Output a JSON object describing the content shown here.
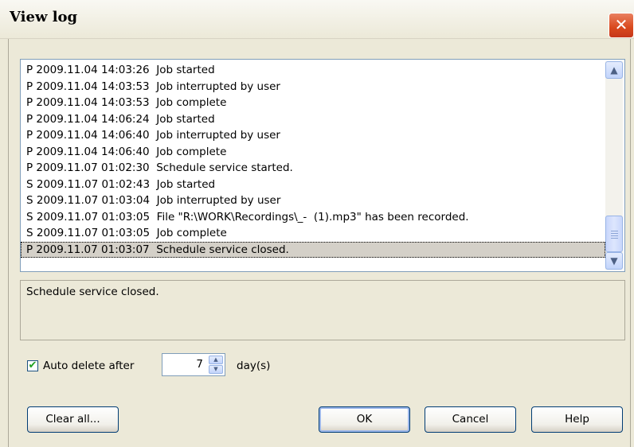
{
  "window": {
    "title": "View log",
    "close_glyph": "✕"
  },
  "log": {
    "rows": [
      "P 2009.11.04 14:03:26  Job started",
      "P 2009.11.04 14:03:53  Job interrupted by user",
      "P 2009.11.04 14:03:53  Job complete",
      "P 2009.11.04 14:06:24  Job started",
      "P 2009.11.04 14:06:40  Job interrupted by user",
      "P 2009.11.04 14:06:40  Job complete",
      "P 2009.11.07 01:02:30  Schedule service started.",
      "S 2009.11.07 01:02:43  Job started",
      "S 2009.11.07 01:03:04  Job interrupted by user",
      "S 2009.11.07 01:03:05  File \"R:\\WORK\\Recordings\\_-  (1).mp3\" has been recorded.",
      "S 2009.11.07 01:03:05  Job complete",
      "P 2009.11.07 01:03:07  Schedule service closed."
    ],
    "selected_index": 11
  },
  "details": {
    "text": "Schedule service closed."
  },
  "auto_delete": {
    "label": "Auto delete after",
    "checked": true,
    "check_glyph": "✔",
    "value": "7",
    "unit": "day(s)"
  },
  "buttons": {
    "clear_all": "Clear all...",
    "ok": "OK",
    "cancel": "Cancel",
    "help": "Help"
  },
  "icons": {
    "scroll_up": "▲",
    "scroll_down": "▼",
    "spin_up": "▲",
    "spin_down": "▼"
  }
}
